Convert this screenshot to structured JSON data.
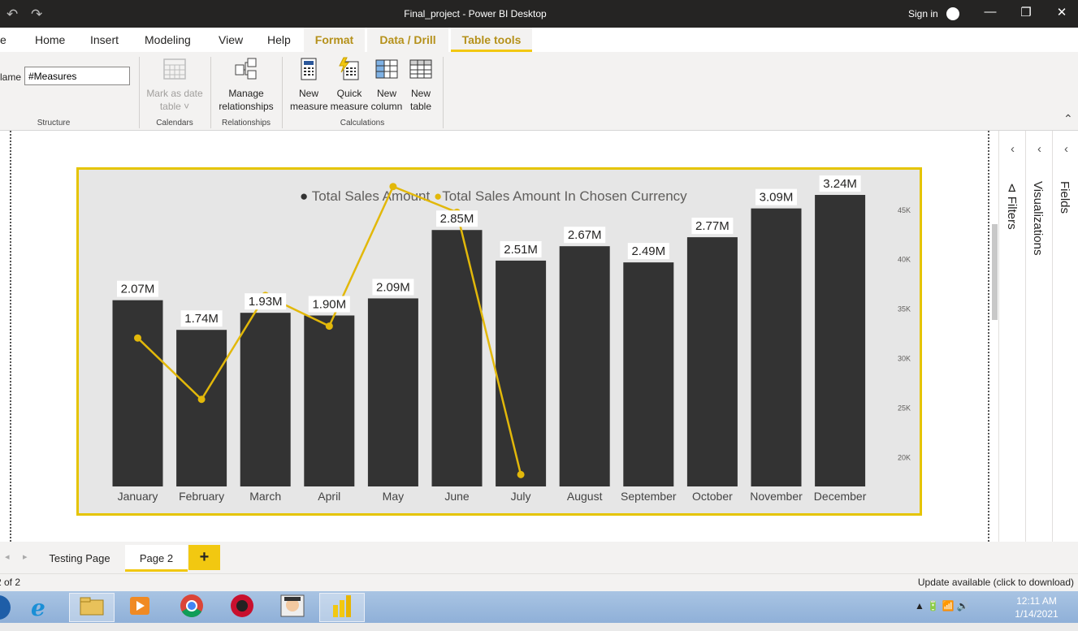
{
  "window": {
    "title": "Final_project - Power BI Desktop",
    "sign_in": "Sign in",
    "undo_icon": "↶",
    "redo_icon": "↷",
    "minimize": "—",
    "maximize": "❐",
    "close": "✕"
  },
  "menu": {
    "left_fragment": "e",
    "tabs": [
      "Home",
      "Insert",
      "Modeling",
      "View",
      "Help",
      "Format",
      "Data / Drill",
      "Table tools"
    ]
  },
  "ribbon": {
    "name_label": "lame",
    "name_value": "#Measures",
    "mark_as_date": "Mark as date",
    "mark_as_date_2": "table ˅",
    "manage": "Manage",
    "relationships": "relationships",
    "new_measure_1": "New",
    "new_measure_2": "measure",
    "quick_measure_1": "Quick",
    "quick_measure_2": "measure",
    "new_column_1": "New",
    "new_column_2": "column",
    "new_table_1": "New",
    "new_table_2": "table",
    "groups": {
      "structure": "Structure",
      "calendars": "Calendars",
      "relationships": "Relationships",
      "calculations": "Calculations"
    },
    "collapse": "⌃"
  },
  "right_panels": {
    "chevron": "‹",
    "filters": "Filters",
    "visualizations": "Visualizations",
    "fields": "Fields"
  },
  "pages": {
    "nav_prev": "◂",
    "nav_next": "▸",
    "tabs": [
      "Testing Page",
      "Page 2"
    ],
    "add": "+"
  },
  "status": {
    "left": "2 of 2",
    "right": "Update available (click to download)"
  },
  "taskbar": {
    "time": "12:11 AM",
    "date": "1/14/2021",
    "tray": "▲ 🔋 📶 🔊"
  },
  "colors": {
    "bar": "#333333",
    "line": "#e2b80a",
    "border": "#e5c400",
    "accent": "#f2c811"
  },
  "chart_data": {
    "type": "bar",
    "categories": [
      "January",
      "February",
      "March",
      "April",
      "May",
      "June",
      "July",
      "August",
      "September",
      "October",
      "November",
      "December"
    ],
    "series": [
      {
        "name": "Total Sales Amount",
        "type": "bar",
        "axis": "left",
        "values": [
          2.07,
          1.74,
          1.93,
          1.9,
          2.09,
          2.85,
          2.51,
          2.67,
          2.49,
          2.77,
          3.09,
          3.24
        ],
        "labels": [
          "2.07M",
          "1.74M",
          "1.93M",
          "1.90M",
          "2.09M",
          "2.85M",
          "2.51M",
          "2.67M",
          "2.49M",
          "2.77M",
          "3.09M",
          "3.24M"
        ]
      },
      {
        "name": "Total Sales Amount In Chosen Currency",
        "type": "line",
        "axis": "right",
        "values": [
          32000,
          25800,
          36300,
          33200,
          47300,
          44700,
          18200,
          null,
          null,
          null,
          null,
          null
        ]
      }
    ],
    "y_right_ticks": [
      "20K",
      "25K",
      "30K",
      "35K",
      "40K",
      "45K"
    ],
    "y_right_range": [
      17000,
      49000
    ],
    "y_left_range": [
      0,
      3.52
    ],
    "legend_position": "top-center",
    "grid": false
  }
}
